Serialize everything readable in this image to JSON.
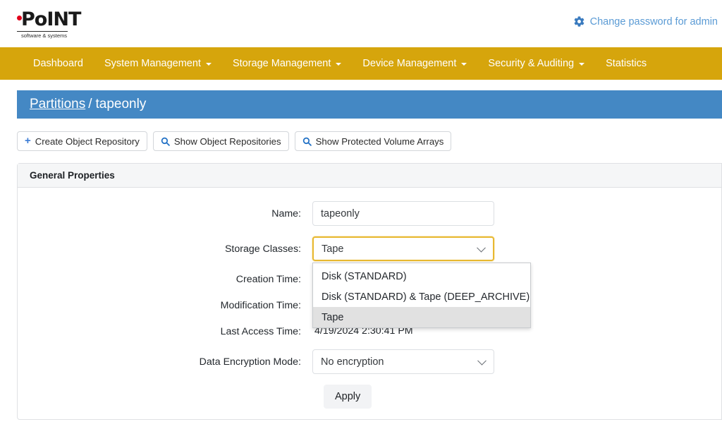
{
  "brand": {
    "logo_word": "PoINT",
    "logo_tagline": "software & systems",
    "accent_red": "#e2001a"
  },
  "header": {
    "change_password_label": "Change password for admin",
    "link_color": "#5b9bd5"
  },
  "navbar": {
    "background": "#d6a50c",
    "items": [
      {
        "label": "Dashboard",
        "has_caret": false
      },
      {
        "label": "System Management",
        "has_caret": true
      },
      {
        "label": "Storage Management",
        "has_caret": true
      },
      {
        "label": "Device Management",
        "has_caret": true
      },
      {
        "label": "Security & Auditing",
        "has_caret": true
      },
      {
        "label": "Statistics",
        "has_caret": false
      }
    ]
  },
  "breadcrumb": {
    "background": "#4488c4",
    "link": "Partitions",
    "separator": "/",
    "current": "tapeonly"
  },
  "toolbar": {
    "create_object_repository": "Create Object Repository",
    "show_object_repositories": "Show Object Repositories",
    "show_protected_volume_arrays": "Show Protected Volume Arrays",
    "plus_glyph": "+"
  },
  "panel": {
    "title": "General Properties"
  },
  "form": {
    "name": {
      "label": "Name:",
      "value": "tapeonly",
      "placeholder": ""
    },
    "storage_classes": {
      "label": "Storage Classes:",
      "value": "Tape",
      "focus_border": "#e8b931",
      "options": [
        "Disk (STANDARD)",
        "Disk (STANDARD) & Tape (DEEP_ARCHIVE)",
        "Tape"
      ],
      "selected_index": 2,
      "expanded": true
    },
    "creation_time": {
      "label": "Creation Time:",
      "value": ""
    },
    "modification_time": {
      "label": "Modification Time:",
      "value": ""
    },
    "last_access_time": {
      "label": "Last Access Time:",
      "value": "4/19/2024 2:30:41 PM"
    },
    "data_encryption_mode": {
      "label": "Data Encryption Mode:",
      "value": "No encryption",
      "options": [
        "No encryption"
      ]
    },
    "apply_label": "Apply"
  }
}
